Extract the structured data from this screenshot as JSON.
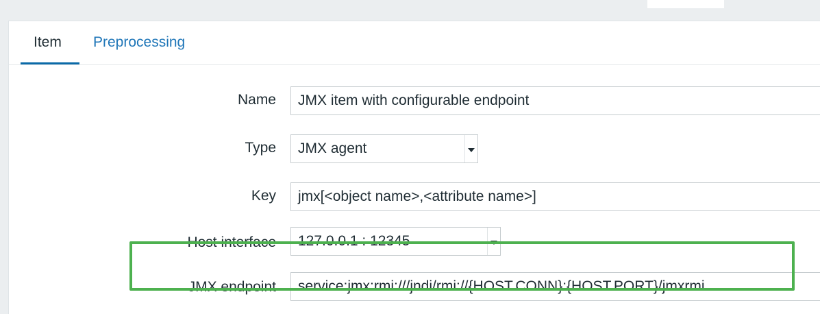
{
  "tabs": [
    {
      "label": "Item"
    },
    {
      "label": "Preprocessing"
    }
  ],
  "form": {
    "name": {
      "label": "Name",
      "value": "JMX item with configurable endpoint"
    },
    "type": {
      "label": "Type",
      "value": "JMX agent"
    },
    "key": {
      "label": "Key",
      "value": "jmx[<object name>,<attribute name>]"
    },
    "host_interface": {
      "label": "Host interface",
      "value": "127.0.0.1 : 12345"
    },
    "jmx_endpoint": {
      "label": "JMX endpoint",
      "value": "service:jmx:rmi:///jndi/rmi://{HOST.CONN}:{HOST.PORT}/jmxrmi"
    }
  },
  "colors": {
    "highlight": "#4db14f",
    "tab_active_underline": "#0b6aa8",
    "link": "#1f76b8"
  },
  "icons": {
    "select_arrow": "chevron-down-icon"
  }
}
